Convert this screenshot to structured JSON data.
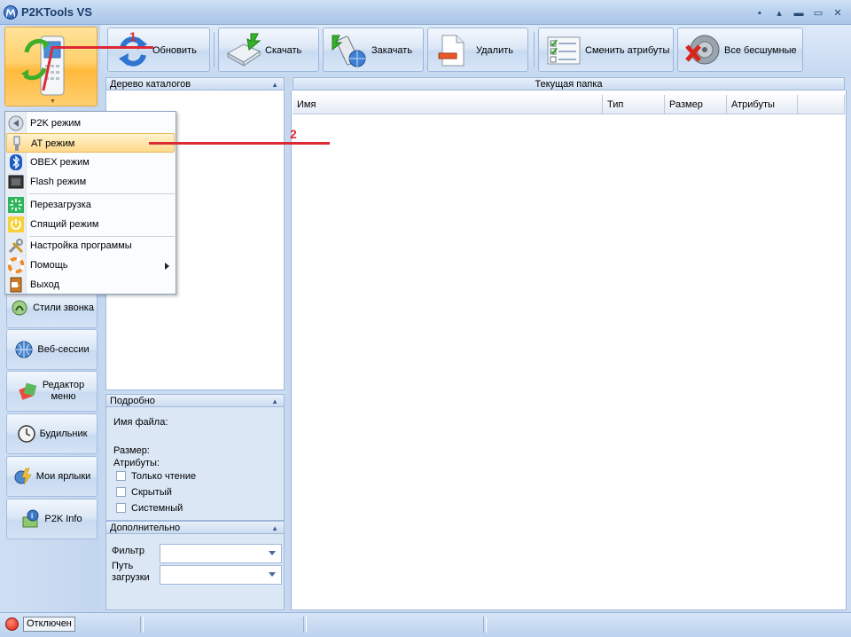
{
  "window": {
    "title": "P2KTools VS"
  },
  "toolbar": {
    "refresh": "Обновить",
    "download": "Скачать",
    "upload": "Закачать",
    "delete": "Удалить",
    "attributes": "Сменить атрибуты",
    "silent": "Все бесшумные"
  },
  "mode_menu": {
    "items": [
      "P2K режим",
      "AT режим",
      "OBEX режим",
      "Flash режим",
      "Перезагрузка",
      "Спящий режим",
      "Настройка программы",
      "Помощь",
      "Выход"
    ],
    "highlighted": "AT режим"
  },
  "sidebar": {
    "items": [
      "Стили звонка",
      "Веб-сессии",
      "Редактор меню",
      "Будильник",
      "Мои ярлыки",
      "P2K Info"
    ]
  },
  "tree_panel": {
    "title": "Дерево каталогов"
  },
  "details_panel": {
    "title": "Подробно",
    "filename_label": "Имя файла:",
    "size_label": "Размер:",
    "attrs_label": "Атрибуты:",
    "readonly": "Только чтение",
    "hidden": "Скрытый",
    "system": "Системный"
  },
  "extra_panel": {
    "title": "Дополнительно",
    "filter_label": "Фильтр",
    "path_label_1": "Путь",
    "path_label_2": "загрузки"
  },
  "folder_panel": {
    "title": "Текущая папка",
    "columns": [
      "Имя",
      "Тип",
      "Размер",
      "Атрибуты"
    ]
  },
  "status": {
    "text": "Отключен"
  },
  "annotations": [
    "1",
    "2"
  ],
  "colors": {
    "annotation": "#dc2a35",
    "accent": "#ffd06b"
  }
}
